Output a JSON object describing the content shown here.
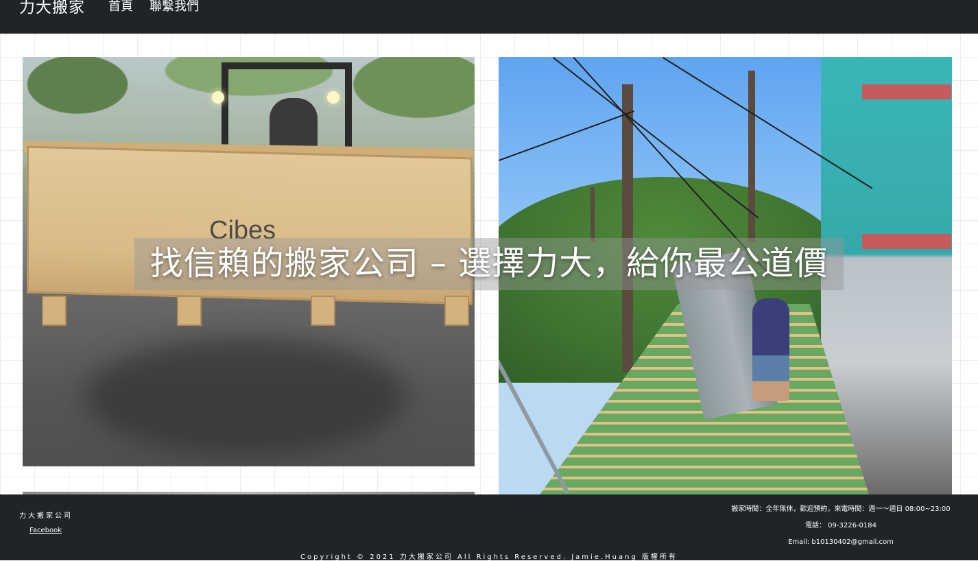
{
  "navbar": {
    "brand": "力大搬家",
    "links": [
      "首頁",
      "聯繫我們"
    ]
  },
  "hero": {
    "title": "找信賴的搬家公司 – 選擇力大，給你最公道價"
  },
  "photos": {
    "left_crate_text": "Cibes"
  },
  "footer": {
    "company": "力大搬家公司",
    "facebook": "Facebook",
    "hours": "搬家時間：全年無休，歡迎預約，來電時間：週一～週日 08:00~23:00",
    "phone": "電話： 09-3226-0184",
    "email": "Email: b10130402@gmail.com",
    "copyright": "Copyright © 2021 力大搬家公司 All Rights Reserved. Jamie.Huang 版權所有"
  },
  "colors": {
    "navbar_bg": "#1f2429",
    "footer_bg": "#1f2429",
    "text_light": "#ffffff"
  }
}
